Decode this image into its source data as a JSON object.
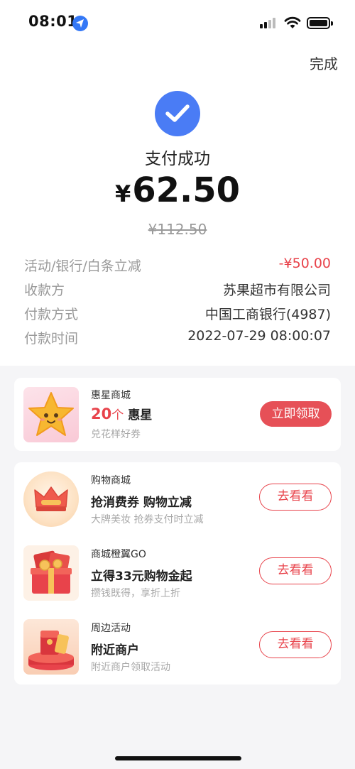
{
  "status_bar": {
    "time": "08:01"
  },
  "header": {
    "done_label": "完成"
  },
  "result": {
    "title": "支付成功",
    "currency": "¥",
    "amount": "62.50",
    "original_amount": "¥112.50"
  },
  "details": [
    {
      "label": "活动/银行/白条立减",
      "value": "-¥50.00",
      "highlight": true
    },
    {
      "label": "收款方",
      "value": "苏果超市有限公司"
    },
    {
      "label": "付款方式",
      "value": "中国工商银行(4987)"
    },
    {
      "label": "付款时间",
      "value": "2022-07-29 08:00:07"
    }
  ],
  "promo_card": {
    "title": "惠星商城",
    "count": "20",
    "unit": "个",
    "reward": "惠星",
    "subtitle": "兑花样好券",
    "button": "立即领取",
    "icon": "star-mascot-icon"
  },
  "list_items": [
    {
      "title": "购物商城",
      "headline": "抢消费券 购物立减",
      "subtitle": "大牌美妆 抢券支付时立减",
      "button": "去看看",
      "icon": "crown-icon"
    },
    {
      "title": "商城橙翼GO",
      "headline": "立得33元购物金起",
      "subtitle": "攒钱既得，享折上折",
      "button": "去看看",
      "icon": "gift-box-icon"
    },
    {
      "title": "周边活动",
      "headline": "附近商户",
      "subtitle": "附近商户领取活动",
      "button": "去看看",
      "icon": "red-packet-icon"
    }
  ],
  "colors": {
    "accent_blue": "#4a7cf5",
    "accent_red": "#e8434b",
    "background": "#f5f5f7"
  }
}
